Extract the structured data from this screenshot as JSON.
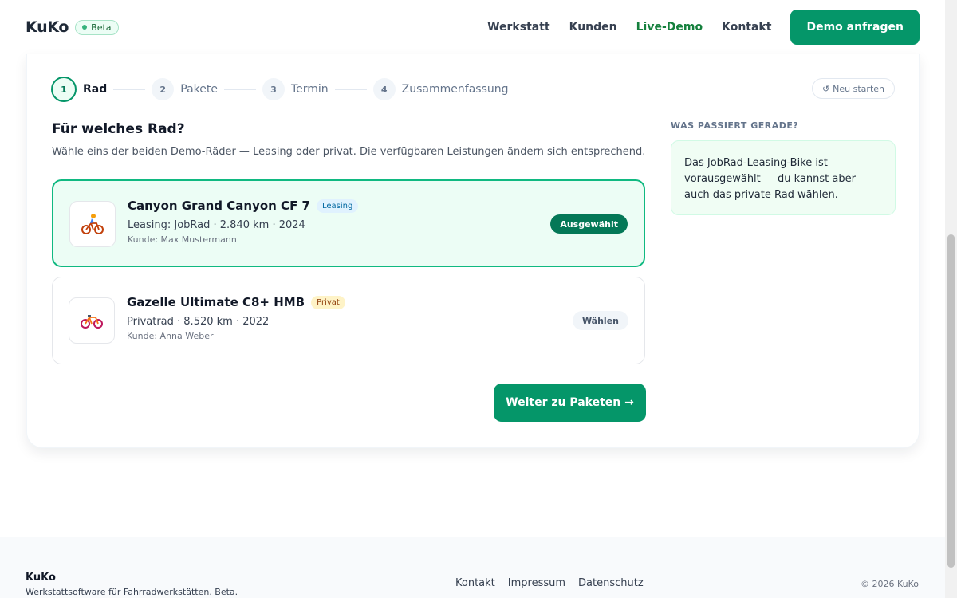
{
  "header": {
    "brand": "KuKo",
    "beta_label": "Beta",
    "nav": [
      "Werkstatt",
      "Kunden",
      "Live-Demo",
      "Kontakt"
    ],
    "cta_label": "Demo anfragen"
  },
  "stepper": {
    "steps": [
      {
        "num": "1",
        "label": "Rad"
      },
      {
        "num": "2",
        "label": "Pakete"
      },
      {
        "num": "3",
        "label": "Termin"
      },
      {
        "num": "4",
        "label": "Zusammenfassung"
      }
    ],
    "restart_label": "Neu starten"
  },
  "main": {
    "title": "Für welches Rad?",
    "description": "Wähle eins der beiden Demo-Räder — Leasing oder privat. Die verfügbaren Leistungen ändern sich entsprechend.",
    "bikes": [
      {
        "name": "Canyon Grand Canyon CF 7",
        "tag": "Leasing",
        "meta": "Leasing: JobRad · 2.840 km · 2024",
        "customer": "Kunde: Max Mustermann",
        "status": "Ausgewählt"
      },
      {
        "name": "Gazelle Ultimate C8+ HMB",
        "tag": "Privat",
        "meta": "Privatrad · 8.520 km · 2022",
        "customer": "Kunde: Anna Weber",
        "status": "Wählen"
      }
    ],
    "next_label": "Weiter zu Paketen →"
  },
  "side": {
    "title": "WAS PASSIERT GERADE?",
    "text": "Das JobRad-Leasing-Bike ist vorausgewählt — du kannst aber auch das private Rad wählen."
  },
  "footer": {
    "brand": "KuKo",
    "tagline": "Werkstattsoftware für Fahrradwerkstätten. Beta.",
    "links": [
      "Kontakt",
      "Impressum",
      "Datenschutz"
    ],
    "copyright": "© 2026 KuKo"
  },
  "colors": {
    "accent": "#059669",
    "selected_bg": "#ecfdf5"
  }
}
